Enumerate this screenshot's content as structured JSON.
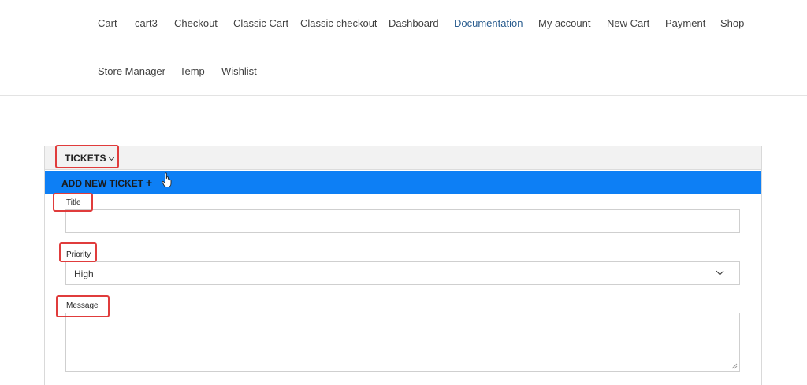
{
  "nav": {
    "items": [
      {
        "label": "Cart"
      },
      {
        "label": "cart3"
      },
      {
        "label": "Checkout"
      },
      {
        "label": "Classic Cart"
      },
      {
        "label": "Classic checkout"
      },
      {
        "label": "Dashboard"
      },
      {
        "label": "Documentation",
        "active": true
      },
      {
        "label": "My account"
      },
      {
        "label": "New Cart"
      },
      {
        "label": "Payment"
      },
      {
        "label": "Shop"
      },
      {
        "label": "Store Manager"
      },
      {
        "label": "Temp"
      },
      {
        "label": "Wishlist"
      }
    ]
  },
  "tickets": {
    "toggle_label": "TICKETS",
    "add_label": "ADD NEW TICKET",
    "add_icon": "+",
    "form": {
      "title_label": "Title",
      "title_value": "",
      "priority_label": "Priority",
      "priority_value": "High",
      "message_label": "Message",
      "message_value": ""
    }
  },
  "colors": {
    "accent_blue": "#0d7ff5",
    "active_nav": "#2a5d8f",
    "highlight_red": "#e03c3c"
  }
}
